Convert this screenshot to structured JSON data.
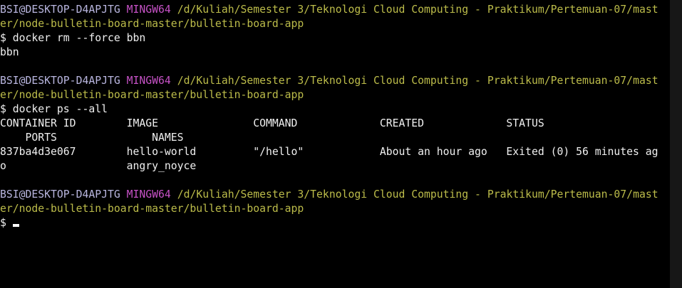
{
  "prompts": [
    {
      "user_host": "BSI@DESKTOP-D4APJTG",
      "system": "MINGW64",
      "path_line1": "/d/Kuliah/Semester 3/Teknologi Cloud Computing - Praktikum/Pertemuan-07/mast",
      "path_line2": "er/node-bulletin-board-master/bulletin-board-app"
    },
    {
      "user_host": "BSI@DESKTOP-D4APJTG",
      "system": "MINGW64",
      "path_line1": "/d/Kuliah/Semester 3/Teknologi Cloud Computing - Praktikum/Pertemuan-07/mast",
      "path_line2": "er/node-bulletin-board-master/bulletin-board-app"
    },
    {
      "user_host": "BSI@DESKTOP-D4APJTG",
      "system": "MINGW64",
      "path_line1": "/d/Kuliah/Semester 3/Teknologi Cloud Computing - Praktikum/Pertemuan-07/mast",
      "path_line2": "er/node-bulletin-board-master/bulletin-board-app"
    }
  ],
  "commands": {
    "rm": "$ docker rm --force bbn",
    "ps": "$ docker ps --all",
    "current": "$ "
  },
  "outputs": {
    "rm_result": "bbn",
    "ps_header1": "CONTAINER ID        IMAGE               COMMAND             CREATED             STATUS",
    "ps_header2": "    PORTS               NAMES",
    "ps_row1": "837ba4d3e067        hello-world         \"/hello\"            About an hour ago   Exited (0) 56 minutes ag",
    "ps_row2": "o                   angry_noyce"
  },
  "colors": {
    "background": "#000000",
    "text": "#f0f0f0",
    "user_host": "#b9b6df",
    "system": "#c652c6",
    "path": "#bcbc4a",
    "scrollbar": "#171717"
  }
}
